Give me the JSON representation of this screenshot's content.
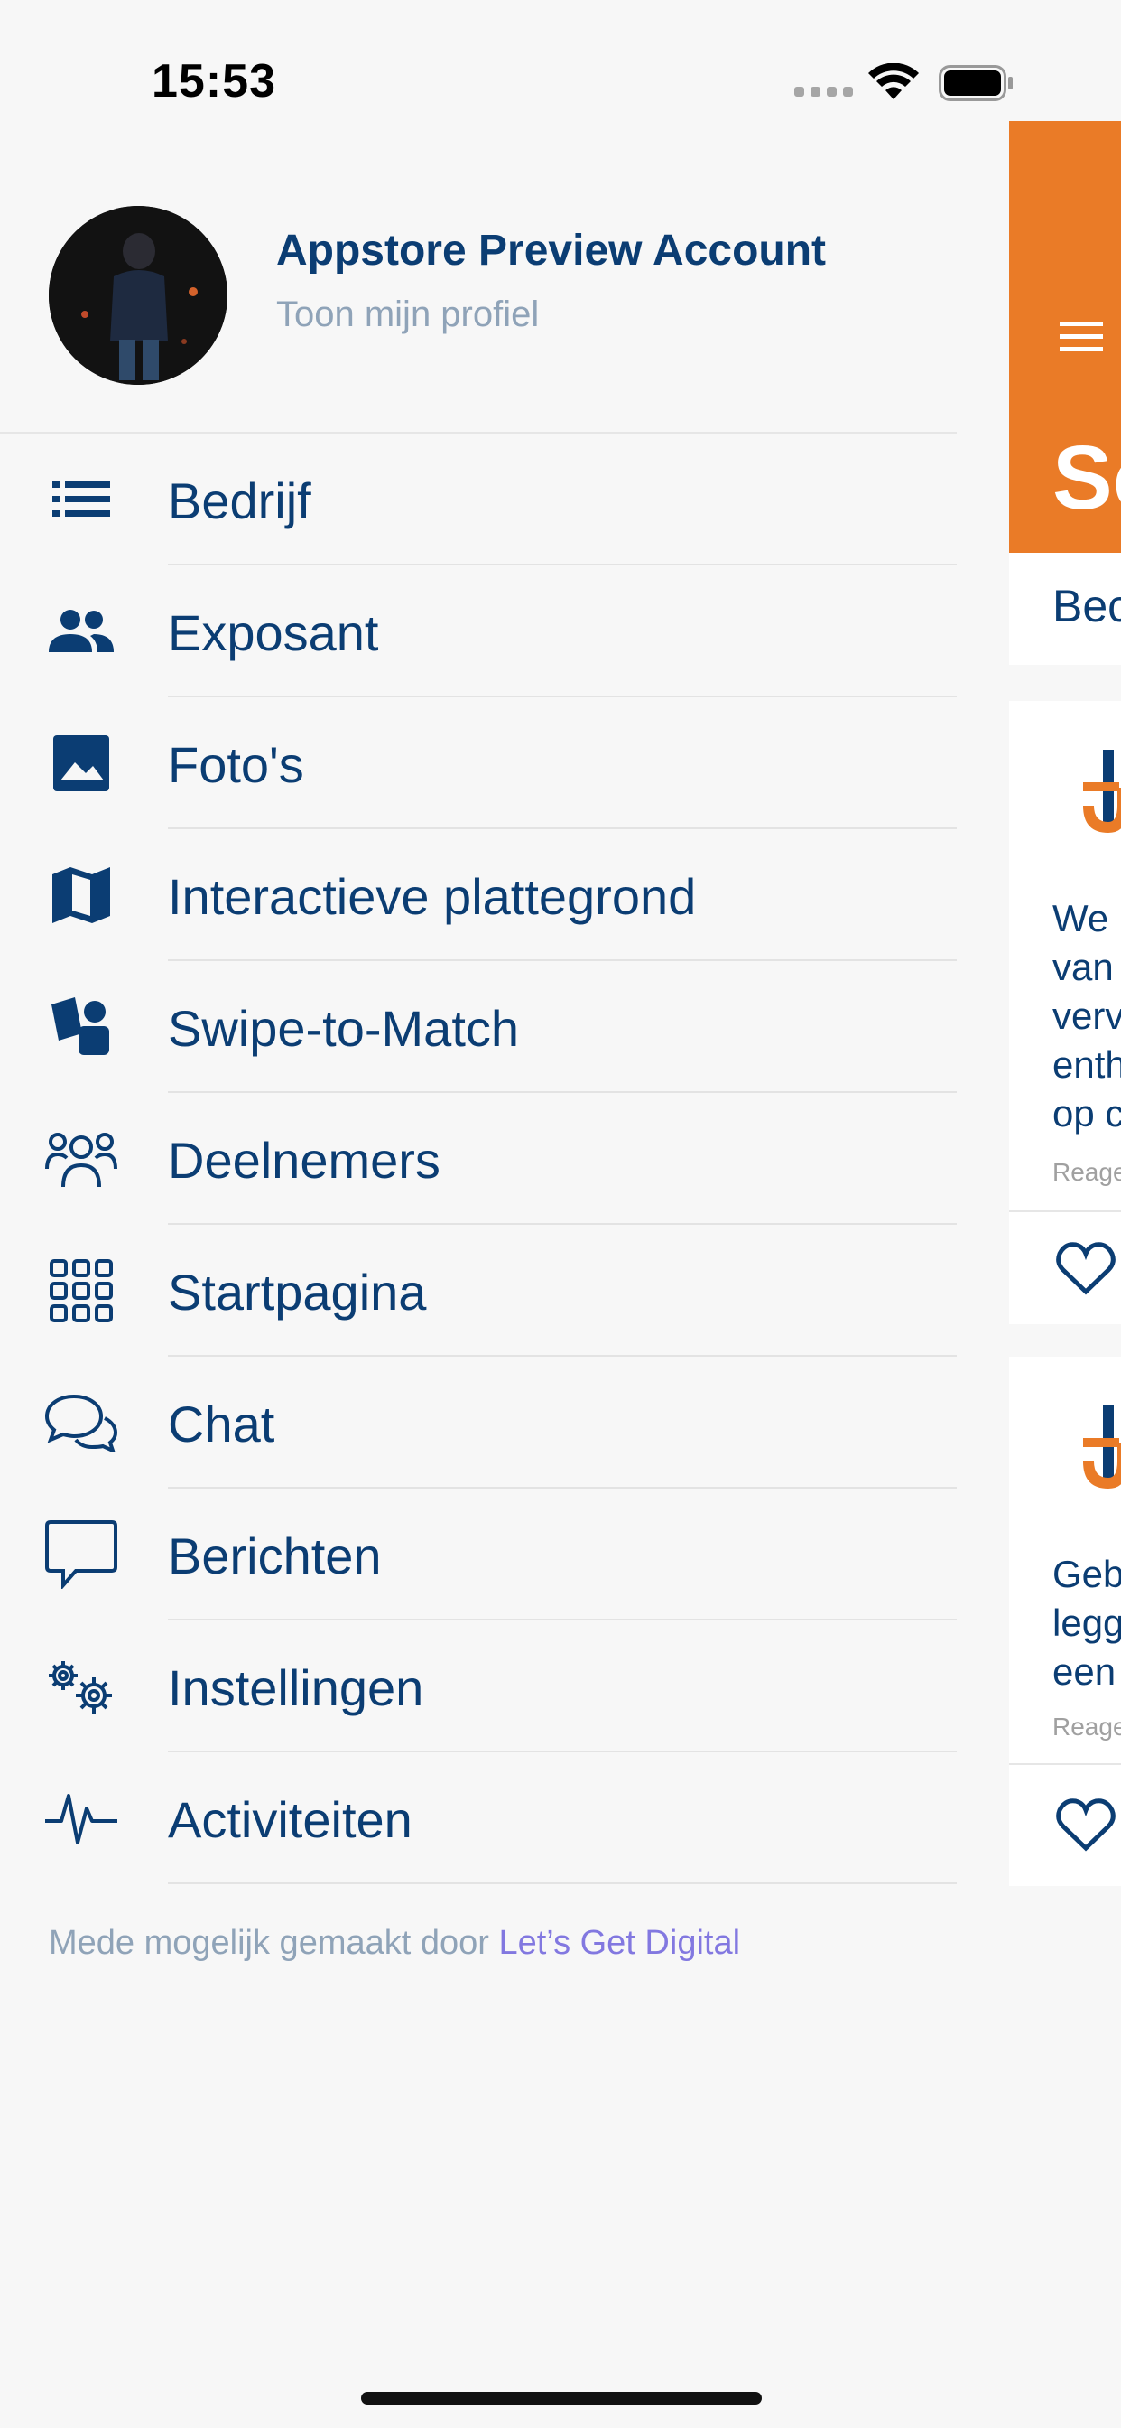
{
  "status_bar": {
    "time": "15:53"
  },
  "profile": {
    "name": "Appstore Preview Account",
    "subtitle": "Toon mijn profiel"
  },
  "menu": {
    "items": [
      {
        "label": "Bedrijf",
        "icon": "list-icon"
      },
      {
        "label": "Exposant",
        "icon": "people-icon"
      },
      {
        "label": "Foto's",
        "icon": "image-icon"
      },
      {
        "label": "Interactieve plattegrond",
        "icon": "map-icon"
      },
      {
        "label": "Swipe-to-Match",
        "icon": "swipe-match-icon"
      },
      {
        "label": "Deelnemers",
        "icon": "participants-icon"
      },
      {
        "label": "Startpagina",
        "icon": "grid-icon"
      },
      {
        "label": "Chat",
        "icon": "chat-icon"
      },
      {
        "label": "Berichten",
        "icon": "message-icon"
      },
      {
        "label": "Instellingen",
        "icon": "settings-icon"
      },
      {
        "label": "Activiteiten",
        "icon": "activity-icon"
      }
    ]
  },
  "footer": {
    "text": "Mede mogelijk gemaakt door ",
    "link": "Let’s Get Digital"
  },
  "content_peek": {
    "header_title": "Sc",
    "tab_label": "Bec",
    "card1": {
      "lines": [
        "We",
        "van",
        "verv",
        "enth",
        "op c"
      ],
      "meta": "Reage"
    },
    "card2": {
      "lines": [
        "Geb",
        "legg",
        "een"
      ],
      "meta": "Reage"
    }
  },
  "colors": {
    "accent_orange": "#ea7b27",
    "text_blue": "#0b3d73",
    "muted": "#8fa3b8",
    "link_purple": "#8278e0"
  }
}
